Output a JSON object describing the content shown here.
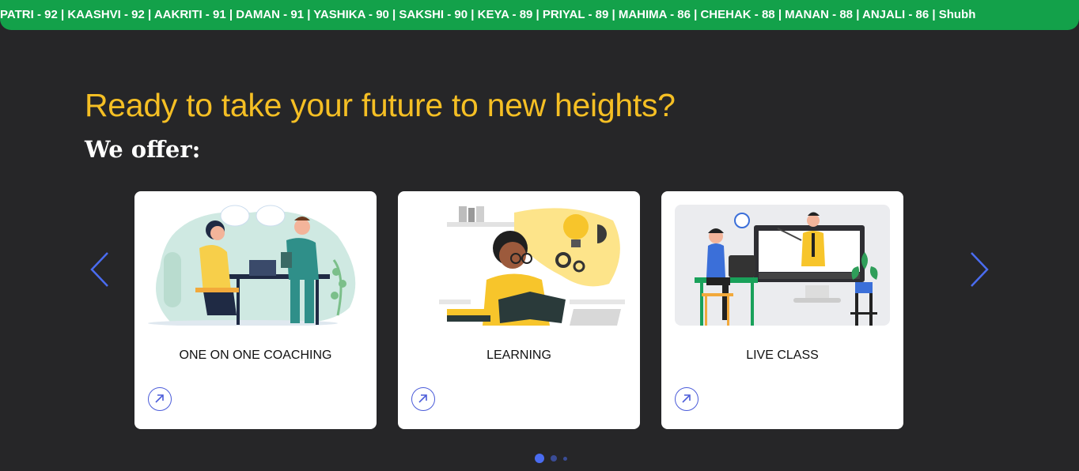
{
  "ticker": {
    "text": "PATRI - 92 | KAASHVI - 92 | AAKRITI - 91 | DAMAN - 91 | YASHIKA - 90 | SAKSHI - 90 | KEYA - 89 | PRIYAL - 89 | MAHIMA - 86 | CHEHAK - 88 | MANAN - 88 | ANJALI - 86 | Shubh",
    "background": "#13a14a"
  },
  "hero": {
    "headline": "Ready to take your future to new heights?",
    "subheading": "We offer:",
    "headline_color": "#f5bf24"
  },
  "carousel": {
    "prev_icon": "chevron-left-icon",
    "next_icon": "chevron-right-icon",
    "accent": "#4a6cf0",
    "cards": [
      {
        "title": "ONE ON ONE COACHING",
        "image": "coaching-illustration",
        "link_icon": "arrow-up-right-icon"
      },
      {
        "title": "LEARNING",
        "image": "learning-illustration",
        "link_icon": "arrow-up-right-icon"
      },
      {
        "title": "LIVE CLASS",
        "image": "live-class-illustration",
        "link_icon": "arrow-up-right-icon"
      }
    ],
    "pagination": {
      "count": 3,
      "active_index": 0
    }
  }
}
